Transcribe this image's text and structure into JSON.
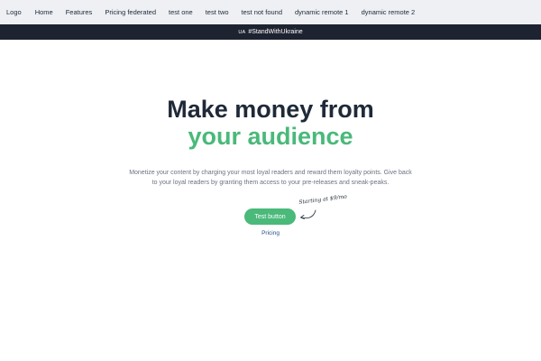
{
  "navbar": {
    "logo": "Logo",
    "items": [
      {
        "label": "Home"
      },
      {
        "label": "Features"
      },
      {
        "label": "Pricing federated"
      },
      {
        "label": "test one"
      },
      {
        "label": "test two"
      },
      {
        "label": "test not found"
      },
      {
        "label": "dynamic remote 1"
      },
      {
        "label": "dynamic remote 2"
      }
    ]
  },
  "banner": {
    "flag": "UA",
    "text": "#StandWithUkraine"
  },
  "hero": {
    "title_line1": "Make money from",
    "title_line2": "your audience",
    "description": "Monetize your content by charging your most loyal readers and reward them loyalty points. Give back to your loyal readers by granting them access to your pre-releases and sneak-peaks.",
    "button_label": "Test button",
    "price_note": "Starting at $9/mo",
    "pricing_link": "Pricing"
  },
  "colors": {
    "accent": "#4ab97a",
    "banner_bg": "#1e2331",
    "navbar_bg": "#eef0f4",
    "heading": "#1f2937",
    "body_text": "#6b7280",
    "link": "#1f4e8c"
  }
}
